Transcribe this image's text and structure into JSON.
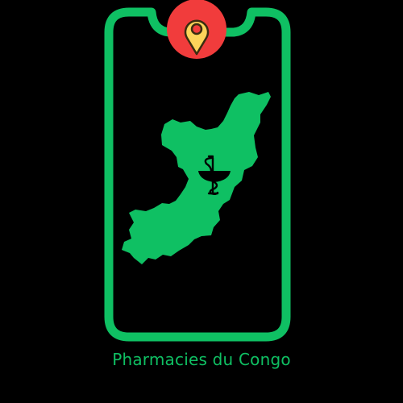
{
  "app": {
    "name": "Pharmacies du Congo"
  },
  "colors": {
    "background": "#000000",
    "brand_green": "#0fc063",
    "pin_red": "#f13c3c",
    "pin_yellow": "#fcd45a",
    "pin_outline": "#3a2d10"
  },
  "icons": {
    "phone": "phone-frame-icon",
    "pin": "location-pin-icon",
    "map": "congo-map-icon",
    "pharmacy": "bowl-of-hygieia-icon"
  }
}
